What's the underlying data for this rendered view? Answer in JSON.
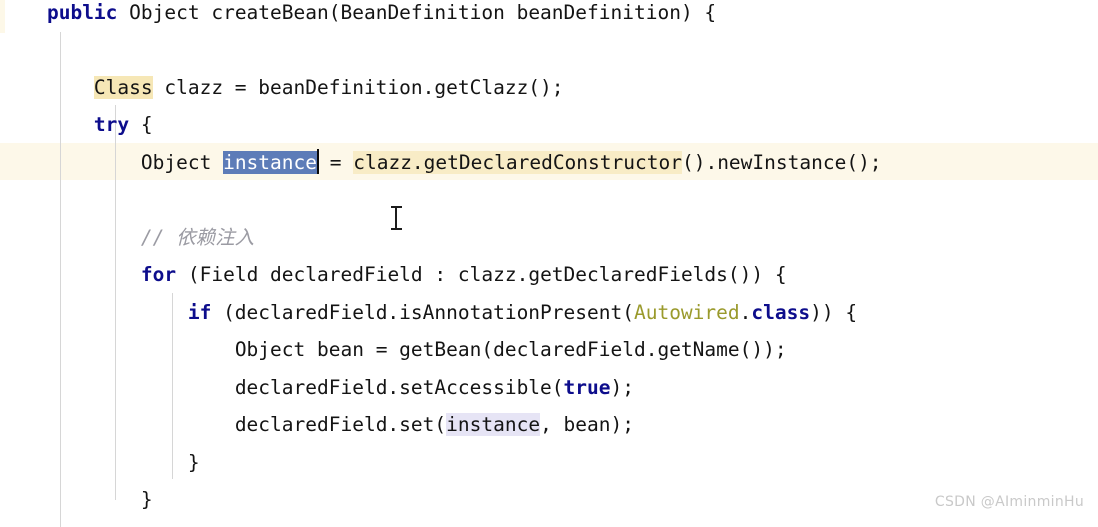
{
  "editor": {
    "language": "java",
    "background": "#ffffff",
    "font_size_px": 19.5,
    "line_height_px": 37.5,
    "colors": {
      "text": "#141414",
      "keyword": "#0d0d8c",
      "annotation": "#9a9a2c",
      "comment": "#9b9ba3",
      "selection_bg": "#5d7cb8",
      "selection_fg": "#ffffff",
      "occurrence_highlight": "#e6e4f5",
      "search_highlight": "#f6e7b6",
      "current_line_bg": "#fdf8e9",
      "indent_guide": "#d6d6d6",
      "watermark": "#c9c9c9"
    }
  },
  "code": {
    "line1": {
      "indent": "    ",
      "kw_public": "public",
      "sig": " Object createBean(BeanDefinition beanDefinition) {"
    },
    "line3": {
      "indent": "        ",
      "hl_class": "Class",
      "rest": " clazz = beanDefinition.getClazz();"
    },
    "line4": {
      "indent": "        ",
      "kw_try": "try",
      "rest": " {"
    },
    "line5": {
      "indent": "            ",
      "obj": "Object ",
      "sel_instance": "instance",
      "eq": " = ",
      "hl_ctor": "clazz.getDeclaredConstructor",
      "tail": "().newInstance();"
    },
    "line7": {
      "indent": "            ",
      "comment_slashes": "// ",
      "comment_cjk": "依赖注入"
    },
    "line8": {
      "indent": "            ",
      "kw_for": "for",
      "rest": " (Field declaredField : clazz.getDeclaredFields()) {"
    },
    "line9": {
      "indent": "                ",
      "kw_if": "if",
      "mid": " (declaredField.isAnnotationPresent(",
      "anno_autowired": "Autowired",
      "dot": ".",
      "kw_class": "class",
      "tail": ")) {"
    },
    "line10": {
      "indent": "                    ",
      "text": "Object bean = getBean(declaredField.getName());"
    },
    "line11": {
      "indent": "                    ",
      "pre": "declaredField.setAccessible(",
      "kw_true": "true",
      "tail": ");"
    },
    "line12": {
      "indent": "                    ",
      "pre": "declaredField.set(",
      "occ_instance": "instance",
      "tail": ", bean);"
    },
    "line13": {
      "indent": "                ",
      "brace": "}"
    },
    "line14": {
      "indent": "            ",
      "brace": "}"
    }
  },
  "watermark": {
    "text": "CSDN @AIminminHu"
  }
}
